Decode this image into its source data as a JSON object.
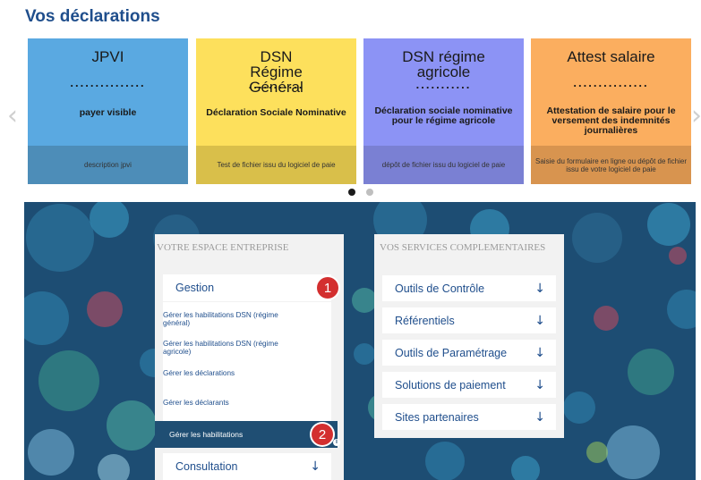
{
  "page_title": "Vos déclarations",
  "carousel": {
    "prev_glyph": "‹",
    "next_glyph": "›",
    "cards": [
      {
        "title": "JPVI",
        "dots": "...............",
        "desc": "payer visible",
        "footer": "description jpvi",
        "color": "#5aa9e1",
        "footer_color": "#4d8db8"
      },
      {
        "title": "DSN Régime Général",
        "dots": "...........",
        "desc": "Déclaration Sociale Nominative",
        "footer": "Test de fichier issu du logiciel de paie",
        "color": "#fde05c",
        "footer_color": "#d9bf4a"
      },
      {
        "title": "DSN régime agricole",
        "dots": "...........",
        "desc": "Déclaration sociale nominative pour le régime agricole",
        "footer": "dépôt de fichier issu du logiciel de paie",
        "color": "#8c93f5",
        "footer_color": "#7a80d3"
      },
      {
        "title": "Attest salaire",
        "dots": "...............",
        "desc": "Attestation de salaire pour le versement des indemnités journalières",
        "footer": "Saisie du formulaire en ligne ou dépôt de fichier issu de votre logiciel de paie",
        "color": "#fbae5f",
        "footer_color": "#d8944f"
      }
    ],
    "pager": {
      "active_color": "#1a1a1a",
      "inactive_color": "#bfbfbf"
    }
  },
  "espace": {
    "heading": "VOTRE ESPACE ENTREPRISE",
    "gestion_label": "Gestion",
    "badge1": "1",
    "badge2": "2",
    "info_glyph": "i",
    "links": [
      "Gérer les habilitations DSN (régime général)",
      "Gérer les habilitations DSN (régime agricole)",
      "Gérer les déclarations",
      "Gérer les déclarants"
    ],
    "active_link": "Gérer les habilitations",
    "consultation_label": "Consultation",
    "consultation_chevron": "↓"
  },
  "services": {
    "heading": "VOS SERVICES COMPLEMENTAIRES",
    "chevron": "↓",
    "items": [
      "Outils de Contrôle",
      "Référentiels",
      "Outils de Paramétrage",
      "Solutions de paiement",
      "Sites partenaires"
    ]
  },
  "colors": {
    "accent": "#1f4e8c",
    "badge": "#d32f2f",
    "banner": "#1d4d73"
  }
}
